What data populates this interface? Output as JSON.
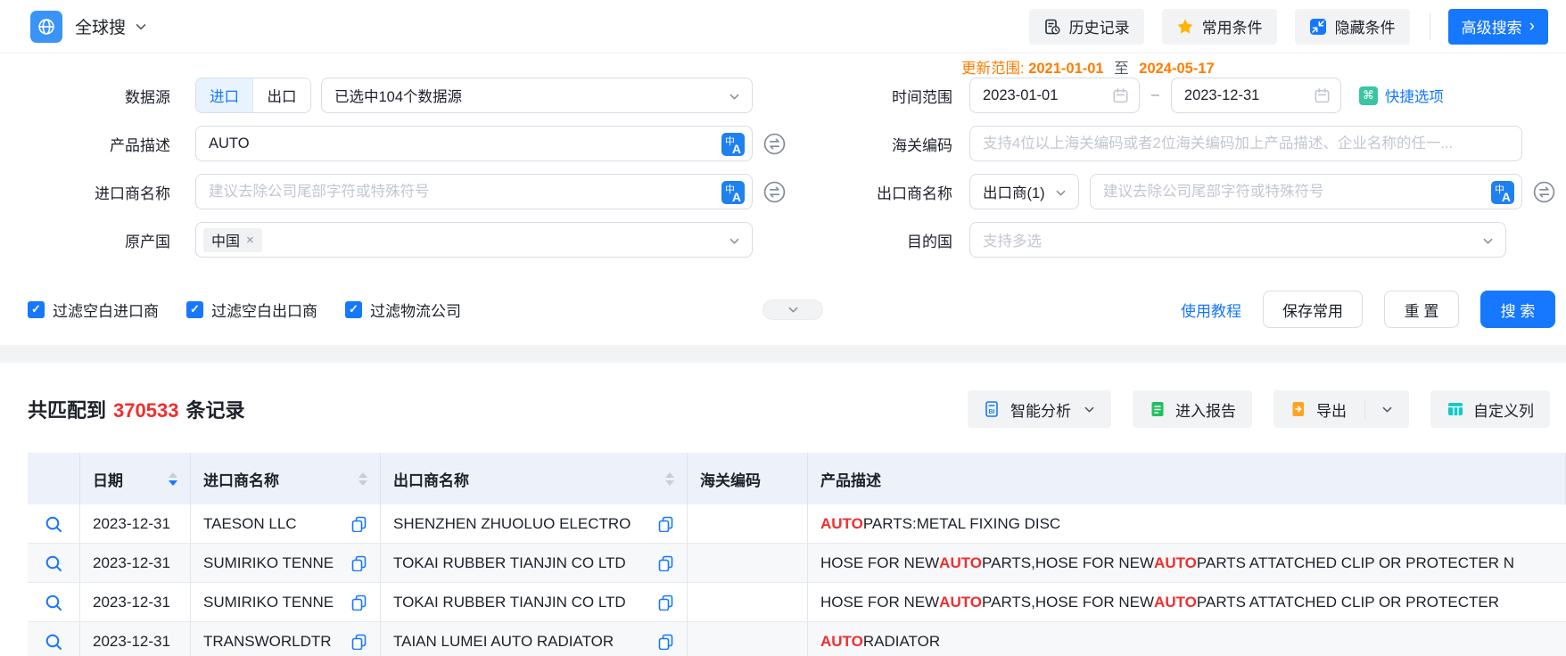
{
  "colors": {
    "primary": "#1677ff",
    "update_orange": "#ff7d00",
    "highlight_red": "#f02e2e",
    "table_header_bg": "#edf1f9",
    "gray_button_bg": "#f2f3f5",
    "star_yellow": "#ffb400",
    "report_green": "#21c05f",
    "export_orange": "#ffa321",
    "columns_teal": "#14c9c9",
    "quick_green": "#3bc4a2",
    "selected_tab_bg": "#e8f3ff"
  },
  "topbar": {
    "app_title": "全球搜",
    "history_label": "历史记录",
    "favorites_label": "常用条件",
    "hide_label": "隐藏条件",
    "advanced_label": "高级搜索",
    "advanced_arrow": "›"
  },
  "form": {
    "update_range": {
      "label": "更新范围:",
      "from": "2021-01-01",
      "to_word": "至",
      "to": "2024-05-17"
    },
    "datasource": {
      "label": "数据源",
      "tab_import": "进口",
      "tab_export": "出口",
      "selected": "已选中104个数据源"
    },
    "product": {
      "label": "产品描述",
      "value": "AUTO"
    },
    "importer": {
      "label": "进口商名称",
      "placeholder": "建议去除公司尾部字符或特殊符号"
    },
    "origin": {
      "label": "原产国",
      "tag": "中国",
      "tag_close": "×"
    },
    "time_range": {
      "label": "时间范围",
      "from": "2023-01-01",
      "dash": "–",
      "to": "2023-12-31",
      "quick_glyph": "⌘",
      "quick_label": "快捷选项"
    },
    "hscode": {
      "label": "海关编码",
      "placeholder": "支持4位以上海关编码或者2位海关编码加上产品描述、企业名称的任一..."
    },
    "exporter": {
      "label": "出口商名称",
      "select_value": "出口商(1)",
      "placeholder": "建议去除公司尾部字符或特殊符号"
    },
    "destination": {
      "label": "目的国",
      "placeholder": "支持多选"
    },
    "check_glyph": "✓",
    "filters": [
      {
        "label": "过滤空白进口商",
        "checked": true
      },
      {
        "label": "过滤空白出口商",
        "checked": true
      },
      {
        "label": "过滤物流公司",
        "checked": true
      }
    ],
    "actions": {
      "tutorial": "使用教程",
      "save": "保存常用",
      "reset": "重 置",
      "search": "搜 索"
    }
  },
  "results": {
    "title": {
      "prefix": "共匹配到",
      "count": "370533",
      "suffix": "条记录"
    },
    "toolbar": {
      "analysis": "智能分析",
      "report": "进入报告",
      "export": "导出",
      "columns": "自定义列"
    }
  },
  "table": {
    "headers": {
      "date": "日期",
      "importer": "进口商名称",
      "exporter": "出口商名称",
      "hscode": "海关编码",
      "product": "产品描述"
    },
    "rows": [
      {
        "date": "2023-12-31",
        "importer": "TAESON LLC",
        "exporter": "SHENZHEN ZHUOLUO ELECTRO",
        "hscode": "",
        "product": [
          {
            "text": "AUTO",
            "highlight": true
          },
          {
            "text": " PARTS:METAL FIXING DISC",
            "highlight": false
          }
        ]
      },
      {
        "date": "2023-12-31",
        "importer": "SUMIRIKO TENNE",
        "exporter": "TOKAI RUBBER TIANJIN CO LTD",
        "hscode": "",
        "product": [
          {
            "text": "HOSE FOR NEW ",
            "highlight": false
          },
          {
            "text": "AUTO",
            "highlight": true
          },
          {
            "text": " PARTS,HOSE FOR NEW ",
            "highlight": false
          },
          {
            "text": "AUTO",
            "highlight": true
          },
          {
            "text": " PARTS ATTATCHED CLIP OR PROTECTER N",
            "highlight": false
          }
        ]
      },
      {
        "date": "2023-12-31",
        "importer": "SUMIRIKO TENNE",
        "exporter": "TOKAI RUBBER TIANJIN CO LTD",
        "hscode": "",
        "product": [
          {
            "text": "HOSE FOR NEW ",
            "highlight": false
          },
          {
            "text": "AUTO",
            "highlight": true
          },
          {
            "text": " PARTS,HOSE FOR NEW ",
            "highlight": false
          },
          {
            "text": "AUTO",
            "highlight": true
          },
          {
            "text": " PARTS ATTATCHED CLIP OR PROTECTER",
            "highlight": false
          }
        ]
      },
      {
        "date": "2023-12-31",
        "importer": "TRANSWORLDTR",
        "exporter": "TAIAN LUMEI AUTO RADIATOR",
        "hscode": "",
        "product": [
          {
            "text": "AUTO",
            "highlight": true
          },
          {
            "text": " RADIATOR",
            "highlight": false
          }
        ]
      }
    ]
  }
}
